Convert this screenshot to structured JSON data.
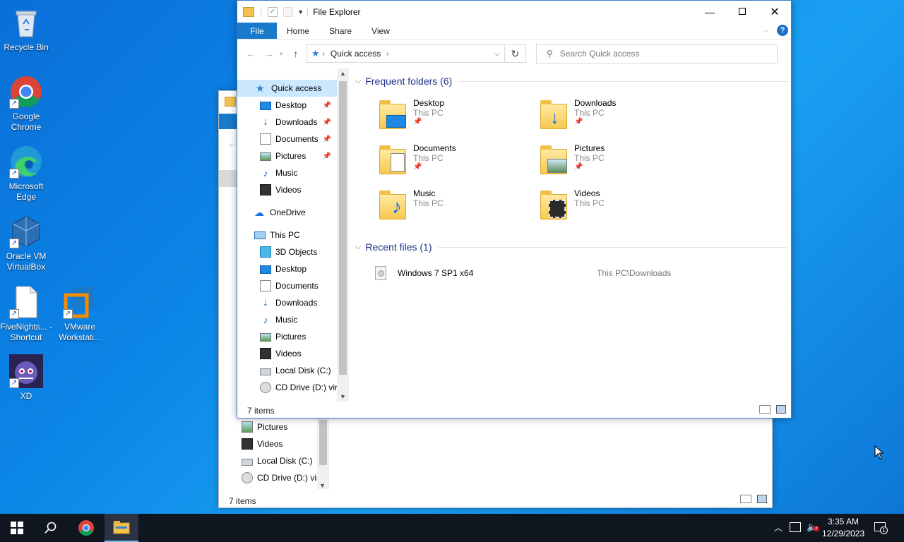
{
  "desktop": {
    "icons": [
      {
        "label": "Recycle Bin",
        "icon": "recycle-bin-icon"
      },
      {
        "label": "Google Chrome",
        "icon": "chrome-icon"
      },
      {
        "label": "Microsoft Edge",
        "icon": "edge-icon"
      },
      {
        "label": "Oracle VM VirtualBox",
        "icon": "virtualbox-icon"
      },
      {
        "label": "FiveNights... - Shortcut",
        "icon": "file-shortcut-icon"
      },
      {
        "label": "VMware Workstati...",
        "icon": "vmware-icon"
      },
      {
        "label": "XD",
        "icon": "xd-game-icon"
      }
    ]
  },
  "front_window": {
    "title": "File Explorer",
    "tabs": [
      "File",
      "Home",
      "Share",
      "View"
    ],
    "address": {
      "path": "Quick access"
    },
    "search": {
      "placeholder": "Search Quick access"
    },
    "nav": {
      "quick_access": "Quick access",
      "quick_items": [
        "Desktop",
        "Downloads",
        "Documents",
        "Pictures",
        "Music",
        "Videos"
      ],
      "onedrive": "OneDrive",
      "this_pc": "This PC",
      "pc_items": [
        "3D Objects",
        "Desktop",
        "Documents",
        "Downloads",
        "Music",
        "Pictures",
        "Videos",
        "Local Disk (C:)",
        "CD Drive (D:) virt"
      ]
    },
    "frequent": {
      "header": "Frequent folders (6)",
      "folders": [
        {
          "name": "Desktop",
          "location": "This PC",
          "pinned": true
        },
        {
          "name": "Downloads",
          "location": "This PC",
          "pinned": true
        },
        {
          "name": "Documents",
          "location": "This PC",
          "pinned": true
        },
        {
          "name": "Pictures",
          "location": "This PC",
          "pinned": true
        },
        {
          "name": "Music",
          "location": "This PC",
          "pinned": false
        },
        {
          "name": "Videos",
          "location": "This PC",
          "pinned": false
        }
      ]
    },
    "recent": {
      "header": "Recent files (1)",
      "files": [
        {
          "name": "Windows 7 SP1 x64",
          "path": "This PC\\Downloads"
        }
      ]
    },
    "status": "7 items"
  },
  "back_window": {
    "nav_items": [
      "Pictures",
      "Videos",
      "Local Disk (C:)",
      "CD Drive (D:) virt"
    ],
    "status": "7 items"
  },
  "taskbar": {
    "time": "3:35 AM",
    "date": "12/29/2023",
    "notification_count": "1"
  }
}
